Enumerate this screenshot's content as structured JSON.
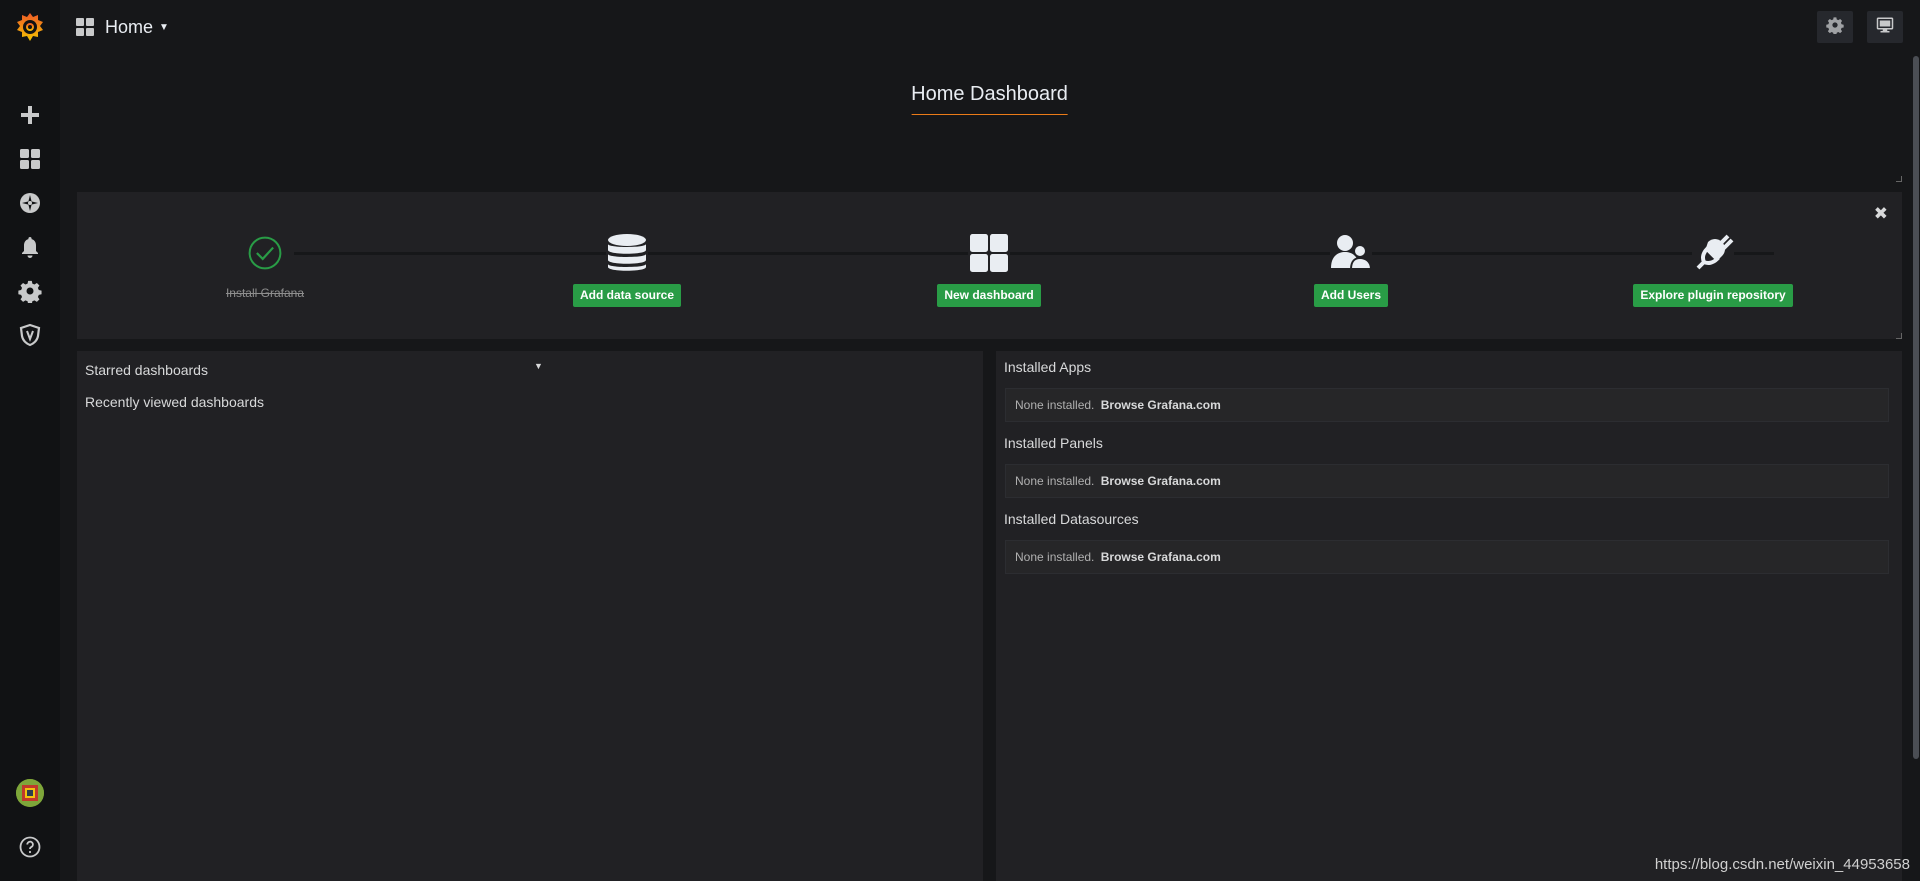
{
  "sidebar": {
    "logo_icon": "grafana-logo",
    "items": [
      {
        "name": "create",
        "icon": "plus-icon"
      },
      {
        "name": "dashboards",
        "icon": "dashboards-icon"
      },
      {
        "name": "explore",
        "icon": "compass-icon"
      },
      {
        "name": "alerting",
        "icon": "bell-icon"
      },
      {
        "name": "configuration",
        "icon": "gear-icon"
      },
      {
        "name": "server-admin",
        "icon": "shield-icon"
      }
    ],
    "bottom": [
      {
        "name": "profile",
        "icon": "avatar"
      },
      {
        "name": "help",
        "icon": "question-icon"
      }
    ]
  },
  "navbar": {
    "title": "Home",
    "buttons": [
      {
        "name": "dashboard-settings",
        "icon": "gear-icon"
      },
      {
        "name": "view-mode",
        "icon": "monitor-icon"
      }
    ]
  },
  "header": {
    "title": "Home Dashboard"
  },
  "getting_started": {
    "steps": [
      {
        "label": "Install Grafana",
        "icon": "check-circle-icon",
        "done": true
      },
      {
        "label": "Add data source",
        "icon": "database-icon",
        "done": false
      },
      {
        "label": "New dashboard",
        "icon": "dashboard-grid-icon",
        "done": false
      },
      {
        "label": "Add Users",
        "icon": "users-icon",
        "done": false
      },
      {
        "label": "Explore plugin repository",
        "icon": "plug-icon",
        "done": false
      }
    ]
  },
  "dashboards_panel": {
    "starred": "Starred dashboards",
    "recent": "Recently viewed dashboards"
  },
  "plugins_panel": {
    "sections": [
      {
        "title": "Installed Apps",
        "none_text": "None installed.",
        "link": "Browse Grafana.com"
      },
      {
        "title": "Installed Panels",
        "none_text": "None installed.",
        "link": "Browse Grafana.com"
      },
      {
        "title": "Installed Datasources",
        "none_text": "None installed.",
        "link": "Browse Grafana.com"
      }
    ]
  },
  "watermark": "https://blog.csdn.net/weixin_44953658",
  "colors": {
    "accent": "#eb7b18",
    "success": "#299c46",
    "panel_bg": "#212124",
    "page_bg": "#161719"
  }
}
